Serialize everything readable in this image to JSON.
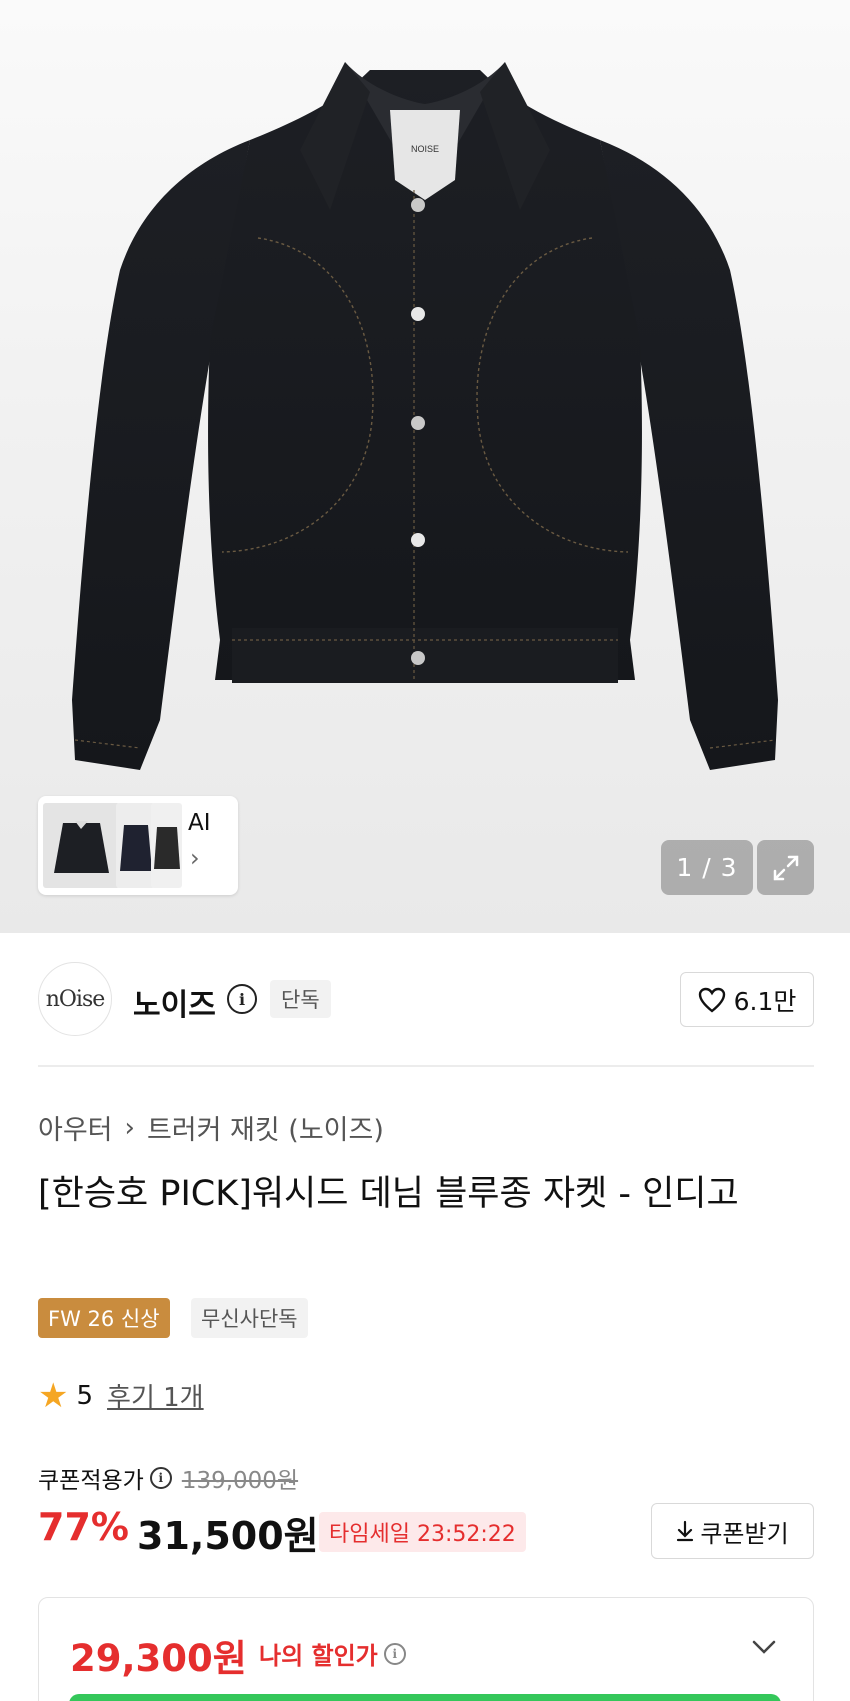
{
  "gallery": {
    "thumbnail_ai_label": "AI",
    "counter": "1 / 3"
  },
  "brand": {
    "logo_text": "nOise",
    "name": "노이즈",
    "exclusive_tag": "단독",
    "likes": "6.1만"
  },
  "breadcrumb": {
    "category": "아우터",
    "subcategory": "트러커 재킷 (노이즈)"
  },
  "product": {
    "title": "[한승호 PICK]워시드 데님 블루종 자켓 - 인디고",
    "badges": [
      "FW 26 신상",
      "무신사단독"
    ],
    "rating": "5",
    "review_link": "후기 1개"
  },
  "price": {
    "coupon_price_label": "쿠폰적용가",
    "original_price": "139,000원",
    "discount_rate": "77%",
    "sale_price": "31,500원",
    "time_sale": "타임세일 23:52:22",
    "coupon_button": "쿠폰받기",
    "my_price": "29,300원",
    "my_price_label": "나의 할인가"
  },
  "colors": {
    "discount_red": "#e52e2e",
    "new_badge": "#c98c3e",
    "star": "#f5a623",
    "button_green": "#34c75a"
  }
}
